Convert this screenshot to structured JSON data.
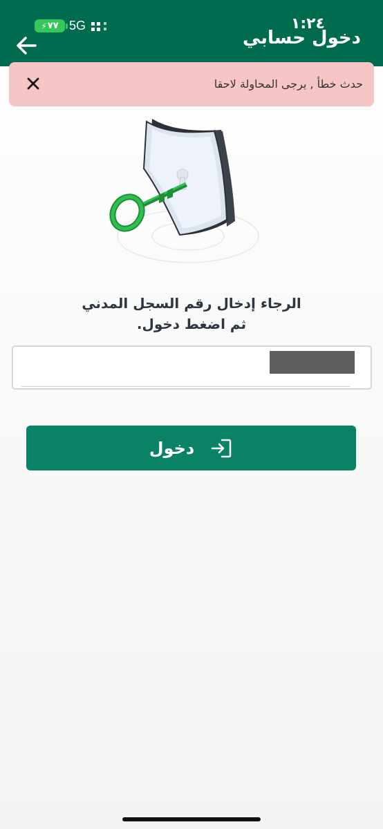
{
  "status_bar": {
    "time": "١:٢٤",
    "battery": "٧٧",
    "network": "5G"
  },
  "header": {
    "title": "دخول حسابي",
    "back_icon": "arrow-left-icon"
  },
  "error_banner": {
    "message": "حدث خطأ , يرجى المحاولة لاحقا",
    "close_icon": "close-icon",
    "background": "#f6c6c7"
  },
  "illustration": {
    "icon": "shield-key-icon"
  },
  "instructions": {
    "line1": "الرجاء إدخال رقم السجل المدني",
    "line2": "ثم اضغط دخول."
  },
  "id_input": {
    "value": "",
    "placeholder": ""
  },
  "login_button": {
    "label": "دخول",
    "icon": "login-icon"
  },
  "colors": {
    "header": "#006b4e",
    "accent": "#0a8266",
    "key_green": "#1aa33a"
  }
}
